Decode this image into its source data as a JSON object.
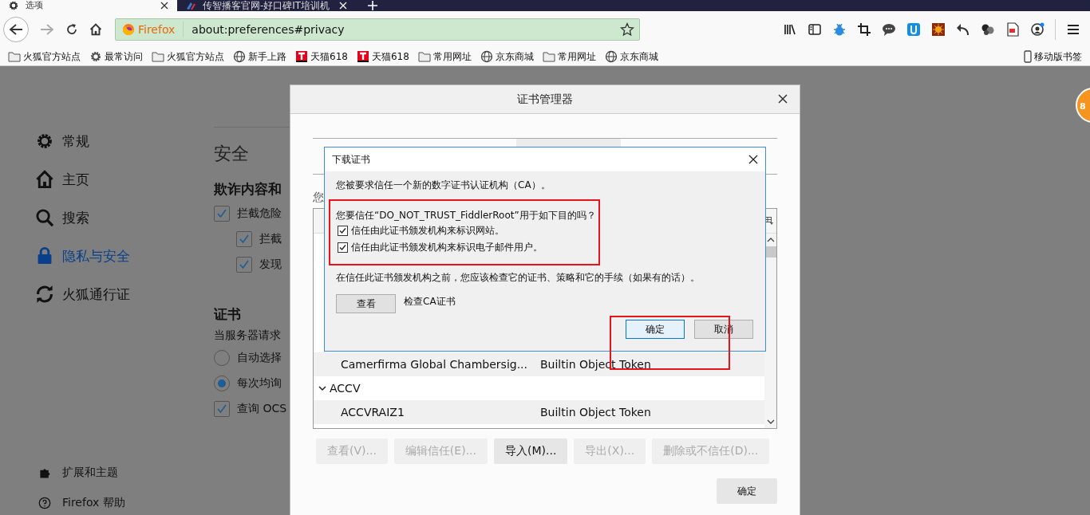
{
  "tabs": [
    {
      "title": "选项",
      "selected": true
    },
    {
      "title": "传智播客官网-好口碑IT培训机",
      "selected": false
    }
  ],
  "url_bar": {
    "identity": "Firefox",
    "url": "about:preferences#privacy"
  },
  "bookmarks": [
    {
      "label": "火狐官方站点",
      "kind": "folder"
    },
    {
      "label": "最常访问",
      "kind": "gear"
    },
    {
      "label": "火狐官方站点",
      "kind": "folder"
    },
    {
      "label": "新手上路",
      "kind": "globe"
    },
    {
      "label": "天猫618",
      "kind": "tmall"
    },
    {
      "label": "天猫618",
      "kind": "tmall"
    },
    {
      "label": "常用网址",
      "kind": "folder"
    },
    {
      "label": "京东商城",
      "kind": "globe"
    },
    {
      "label": "常用网址",
      "kind": "folder"
    },
    {
      "label": "京东商城",
      "kind": "globe"
    }
  ],
  "mobile_bookmarks": "移动版书签",
  "sidebar": {
    "items": [
      {
        "label": "常规",
        "selected": false
      },
      {
        "label": "主页",
        "selected": false
      },
      {
        "label": "搜索",
        "selected": false
      },
      {
        "label": "隐私与安全",
        "selected": true
      },
      {
        "label": "火狐通行证",
        "selected": false
      }
    ],
    "footer": [
      {
        "label": "扩展和主题"
      },
      {
        "label": "Firefox 帮助"
      }
    ]
  },
  "page": {
    "section_title": "安全",
    "groups": [
      {
        "heading": "欺诈内容和",
        "options": [
          {
            "kind": "checkbox",
            "label": "拦截危险",
            "checked": true,
            "children": [
              {
                "kind": "checkbox",
                "label": "拦截",
                "checked": true
              },
              {
                "kind": "checkbox",
                "label": "发现",
                "checked": true
              }
            ]
          }
        ]
      },
      {
        "heading": "证书",
        "description": "当服务器请求",
        "options": [
          {
            "kind": "radio",
            "label": "自动选择",
            "selected": false
          },
          {
            "kind": "radio",
            "label": "每次均询",
            "selected": true
          },
          {
            "kind": "checkbox",
            "label": "查询 OCS",
            "checked": true
          }
        ]
      }
    ]
  },
  "badge": "8",
  "cert_manager": {
    "title": "证书管理器",
    "intro": "您",
    "rows": [
      {
        "kind": "cert",
        "name": "Camerfirma Global Chambersig...",
        "device": "Builtin Object Token"
      },
      {
        "kind": "group",
        "label": "ACCV",
        "expanded": true,
        "children": [
          {
            "kind": "cert",
            "name": "ACCVRAIZ1",
            "device": "Builtin Object Token"
          }
        ]
      }
    ],
    "buttons": [
      {
        "label": "查看(V)...",
        "disabled": true
      },
      {
        "label": "编辑信任(E)...",
        "disabled": true
      },
      {
        "label": "导入(M)...",
        "disabled": false
      },
      {
        "label": "导出(X)...",
        "disabled": true
      },
      {
        "label": "删除或不信任(D)...",
        "disabled": true
      }
    ],
    "ok": "确定"
  },
  "download_dialog": {
    "title": "下载证书",
    "message": "您被要求信任一个新的数字证书认证机构（CA）。",
    "question": "您要信任“DO_NOT_TRUST_FiddlerRoot”用于如下目的吗？",
    "purposes": [
      {
        "label": "信任由此证书颁发机构来标识网站。",
        "checked": true
      },
      {
        "label": "信任由此证书颁发机构来标识电子邮件用户。",
        "checked": true
      }
    ],
    "advice": "在信任此证书颁发机构之前，您应该检查它的证书、策略和它的手续（如果有的话）。",
    "view_button": "查看",
    "view_hint": "检查CA证书",
    "buttons": [
      {
        "label": "确定",
        "focused": true
      },
      {
        "label": "取消",
        "focused": false
      }
    ]
  }
}
